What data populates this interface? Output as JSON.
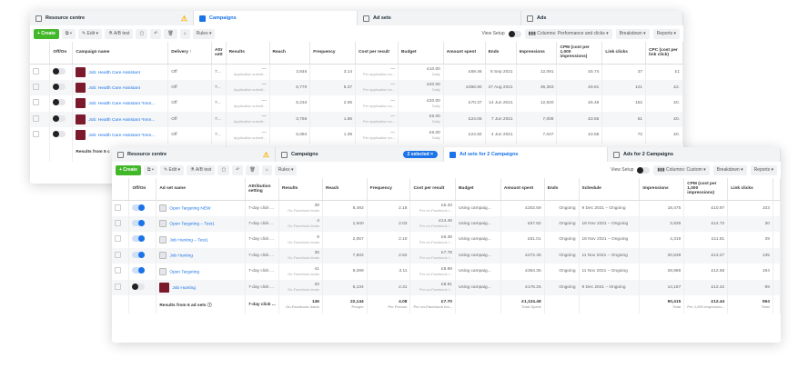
{
  "back": {
    "tabs": [
      "Resource centre",
      "Campaigns",
      "Ad sets",
      "Ads"
    ],
    "toolbar": {
      "create": "+ Create",
      "edit": "Edit",
      "ab_test": "A/B test",
      "rules": "Rules ▾",
      "view_setup": "View Setup",
      "columns": "Columns: Performance and clicks ▾",
      "breakdown": "Breakdown ▾",
      "reports": "Reports ▾"
    },
    "headers": [
      "",
      "Off/On",
      "Campaign name",
      "Delivery ↑",
      "Attr sett",
      "Results",
      "Reach",
      "Frequency",
      "Cost per result",
      "Budget",
      "Amount spent",
      "Ends",
      "Impressions",
      "CPM (cost per 1,000 impressions)",
      "Link clicks",
      "CPC (cost per link click)"
    ],
    "rows": [
      {
        "name": "Job: Health Care Assistant",
        "delivery": "Off",
        "attr": "7...",
        "results": "—",
        "results_sub": "Application submit...",
        "reach": "3,846",
        "frequency": "3.14",
        "cost": "—",
        "cost_sub": "Per application su...",
        "budget": "£10.00",
        "budget_sub": "Daily",
        "spent": "£69.46",
        "ends": "8 Sep 2021",
        "impressions": "12,091",
        "cpm": "£5.74",
        "clicks": "37",
        "cpc": "£1"
      },
      {
        "name": "Job: Health Care Assistant",
        "delivery": "Off",
        "attr": "7...",
        "results": "—",
        "results_sub": "Application submit...",
        "reach": "6,770",
        "frequency": "5.37",
        "cost": "—",
        "cost_sub": "Per application su...",
        "budget": "£20.00",
        "budget_sub": "Daily",
        "spent": "£356.90",
        "ends": "27 Aug 2021",
        "impressions": "36,383",
        "cpm": "£9.81",
        "clicks": "121",
        "cpc": "£2."
      },
      {
        "name": "Job: Health Care Assistant *Imm...",
        "delivery": "Off",
        "attr": "7...",
        "results": "—",
        "results_sub": "Application submit...",
        "reach": "6,234",
        "frequency": "2.06",
        "cost": "—",
        "cost_sub": "Per application su...",
        "budget": "£20.00",
        "budget_sub": "Daily",
        "spent": "£70.37",
        "ends": "14 Jun 2021",
        "impressions": "12,840",
        "cpm": "£5.48",
        "clicks": "152",
        "cpc": "£0."
      },
      {
        "name": "Job: Health Care Assistant *Imm...",
        "delivery": "Off",
        "attr": "7...",
        "results": "—",
        "results_sub": "Application submit...",
        "reach": "3,766",
        "frequency": "1.86",
        "cost": "—",
        "cost_sub": "Per application su...",
        "budget": "£5.00",
        "budget_sub": "Daily",
        "spent": "£24.06",
        "ends": "7 Jun 2021",
        "impressions": "7,008",
        "cpm": "£3.56",
        "clicks": "51",
        "cpc": "£0."
      },
      {
        "name": "Job: Health Care Assistant *Imm...",
        "delivery": "Off",
        "attr": "7...",
        "results": "—",
        "results_sub": "Application submit...",
        "reach": "5,084",
        "frequency": "1.39",
        "cost": "—",
        "cost_sub": "Per application su...",
        "budget": "£5.00",
        "budget_sub": "Daily",
        "spent": "£24.92",
        "ends": "4 Jun 2021",
        "impressions": "7,047",
        "cpm": "£3.58",
        "clicks": "72",
        "cpc": "£0."
      }
    ],
    "footer": "Results from 5 c"
  },
  "front": {
    "tabs": [
      "Resource centre",
      "Campaigns",
      "2 selected ×",
      "Ad sets for 2 Campaigns",
      "Ads for 2 Campaigns"
    ],
    "toolbar": {
      "create": "+ Create",
      "edit": "Edit",
      "ab_test": "A/B test",
      "rules": "Rules ▾",
      "view_setup": "View Setup",
      "columns": "Columns: Custom ▾",
      "breakdown": "Breakdown ▾",
      "reports": "Reports ▾"
    },
    "headers": [
      "",
      "Off/On",
      "Ad set name",
      "Attribution setting",
      "Results",
      "Reach",
      "Frequency",
      "Cost per result",
      "Budget",
      "Amount spent",
      "Ends",
      "Schedule",
      "Impressions",
      "CPM (cost per 1,000 impressions)",
      "Link clicks",
      ""
    ],
    "rows": [
      {
        "on": true,
        "name": "Open Targeting NEW",
        "attr": "7-day click ...",
        "results": "38",
        "results_sub": "On-Facebook leads",
        "reach": "8,492",
        "frequency": "2.18",
        "cost": "£5.33",
        "cost_sub": "Per on-Facebook l...",
        "budget": "Using campaig...",
        "spent": "£202.59",
        "ends": "Ongoing",
        "schedule": "9 Dec 2021 – Ongoing",
        "impressions": "18,475",
        "cpm": "£10.97",
        "clicks": "103"
      },
      {
        "on": true,
        "name": "Open Targeting – Test1",
        "attr": "7-day click ...",
        "results": "4",
        "results_sub": "On-Facebook leads",
        "reach": "1,940",
        "frequency": "2.03",
        "cost": "£14.46",
        "cost_sub": "Per on-Facebook l...",
        "budget": "Using campaig...",
        "spent": "£57.82",
        "ends": "Ongoing",
        "schedule": "18 Nov 2021 – Ongoing",
        "impressions": "3,929",
        "cpm": "£14.72",
        "clicks": "30"
      },
      {
        "on": true,
        "name": "Job Hunting – Test1",
        "attr": "7-day click ...",
        "results": "8",
        "results_sub": "On-Facebook leads",
        "reach": "2,057",
        "frequency": "2.10",
        "cost": "£6.38",
        "cost_sub": "Per on-Facebook l...",
        "budget": "Using campaig...",
        "spent": "£51.01",
        "ends": "Ongoing",
        "schedule": "18 Nov 2021 – Ongoing",
        "impressions": "4,319",
        "cpm": "£11.81",
        "clicks": "39"
      },
      {
        "on": true,
        "name": "Job Hunting",
        "attr": "7-day click ...",
        "results": "35",
        "results_sub": "On-Facebook leads",
        "reach": "7,832",
        "frequency": "2.62",
        "cost": "£7.78",
        "cost_sub": "Per on-Facebook l...",
        "budget": "Using campaig...",
        "spent": "£272.46",
        "ends": "Ongoing",
        "schedule": "11 Nov 2021 – Ongoing",
        "impressions": "20,539",
        "cpm": "£13.27",
        "clicks": "135"
      },
      {
        "on": true,
        "name": "Open Targeting",
        "attr": "7-day click ...",
        "results": "41",
        "results_sub": "On-Facebook leads",
        "reach": "9,299",
        "frequency": "3.11",
        "cost": "£8.89",
        "cost_sub": "Per on-Facebook l...",
        "budget": "Using campaig...",
        "spent": "£364.35",
        "ends": "Ongoing",
        "schedule": "11 Nov 2021 – Ongoing",
        "impressions": "28,966",
        "cpm": "£12.58",
        "clicks": "194"
      },
      {
        "on": false,
        "name": "Job Hunting",
        "attr": "7-day click ...",
        "results": "20",
        "results_sub": "On-Facebook leads",
        "reach": "6,134",
        "frequency": "2.31",
        "cost": "£8.81",
        "cost_sub": "Per on-Facebook l...",
        "budget": "Using campaig...",
        "spent": "£176.25",
        "ends": "Ongoing",
        "schedule": "9 Dec 2021 – Ongoing",
        "impressions": "14,187",
        "cpm": "£12.42",
        "clicks": "89"
      }
    ],
    "total": {
      "label": "Results from 6 ad sets ⓘ",
      "attr": "7-day click ...",
      "results": "146",
      "results_sub": "On-Facebook leads",
      "reach": "22,144",
      "reach_sub": "People",
      "frequency": "4.08",
      "frequency_sub": "Per Person",
      "cost": "£7.70",
      "cost_sub": "Per on-Facebook lea...",
      "spent": "£1,124.48",
      "spent_sub": "Total Spent",
      "impressions": "90,415",
      "impressions_sub": "Total",
      "cpm": "£12.44",
      "cpm_sub": "Per 1,000 impressio...",
      "clicks": "594",
      "clicks_sub": "Total"
    }
  },
  "colors": {
    "accent": "#1a73e8",
    "create": "#42b72a",
    "thumb": "#7a1a2c"
  }
}
